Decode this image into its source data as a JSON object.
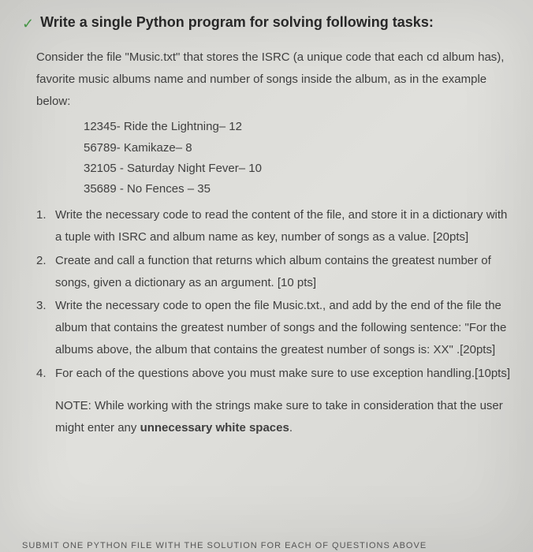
{
  "checkmark": "✓",
  "title": "Write a single Python program for solving following tasks:",
  "intro": "Consider the file \"Music.txt\" that stores the ISRC (a unique code that each cd album has), favorite music albums name and number of songs inside the album, as in the example below:",
  "examples": [
    "12345- Ride the Lightning– 12",
    "56789- Kamikaze– 8",
    "32105 - Saturday Night Fever– 10",
    "35689 - No Fences – 35"
  ],
  "questions": [
    {
      "num": "1.",
      "text": "Write the necessary code to read the content of the file, and store it in a dictionary with a tuple with ISRC and album name as key, number of songs as a value. [20pts]"
    },
    {
      "num": "2.",
      "text": "Create and call a function that returns which album contains the greatest number of songs, given a dictionary as an argument. [10 pts]"
    },
    {
      "num": "3.",
      "text": "Write the necessary code to open the file Music.txt., and add by the end of the file the album that contains the greatest number of songs and the following sentence: \"For the albums above, the album that contains the greatest number of songs is: XX\" .[20pts]"
    },
    {
      "num": "4.",
      "text": "For each of the questions above you must make sure to use exception handling.[10pts]"
    }
  ],
  "note_prefix": "NOTE: While working with the strings make sure to take in consideration that the user might enter any ",
  "note_bold": "unnecessary white spaces",
  "note_suffix": ".",
  "footer": "SUBMIT ONE PYTHON FILE WITH THE SOLUTION FOR EACH OF QUESTIONS ABOVE"
}
